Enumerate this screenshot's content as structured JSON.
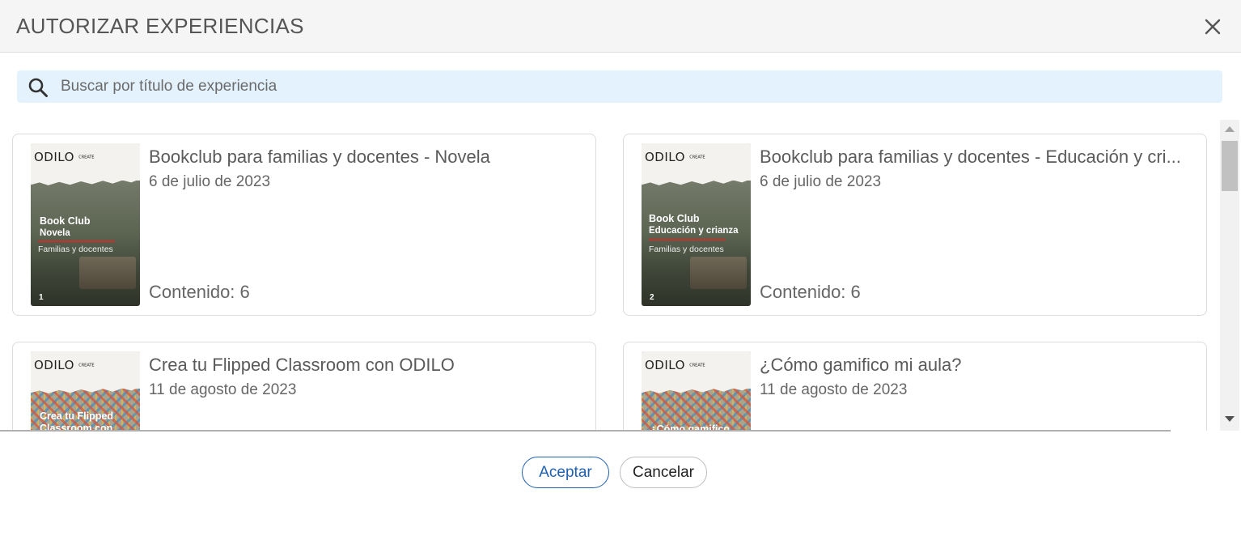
{
  "dialog": {
    "title": "AUTORIZAR EXPERIENCIAS",
    "close_icon": "close-icon"
  },
  "search": {
    "placeholder": "Buscar por título de experiencia",
    "icon": "search-icon",
    "background": "#e3f2fd"
  },
  "cards": [
    {
      "title": "Bookclub para familias y docentes - Novela",
      "date": "6 de julio de 2023",
      "content": "Contenido: 6",
      "thumb": {
        "logo": "ODILO",
        "logo_suffix": "CREATE",
        "line1": "Book Club",
        "line2": "Novela",
        "meta": "Familias y docentes",
        "number": "1"
      }
    },
    {
      "title": "Bookclub para familias y docentes - Educación y cri...",
      "date": "6 de julio de 2023",
      "content": "Contenido: 6",
      "thumb": {
        "logo": "ODILO",
        "logo_suffix": "CREATE",
        "line1": "Book Club",
        "line2": "Educación y crianza",
        "meta": "Familias y docentes",
        "number": "2"
      }
    },
    {
      "title": "Crea tu Flipped Classroom con ODILO",
      "date": "11 de agosto de 2023",
      "content": "",
      "thumb": {
        "logo": "ODILO",
        "logo_suffix": "CREATE",
        "line1": "Crea tu Flipped",
        "line2": "Classroom con",
        "meta": "",
        "number": ""
      }
    },
    {
      "title": "¿Cómo gamifico mi aula?",
      "date": "11 de agosto de 2023",
      "content": "",
      "thumb": {
        "logo": "ODILO",
        "logo_suffix": "CREATE",
        "line1": "¿Cómo gamifico",
        "line2": "",
        "meta": "",
        "number": ""
      }
    }
  ],
  "footer": {
    "accept_label": "Aceptar",
    "cancel_label": "Cancelar"
  },
  "colors": {
    "accent": "#1f5fb0",
    "header_bg": "#f5f5f5"
  }
}
